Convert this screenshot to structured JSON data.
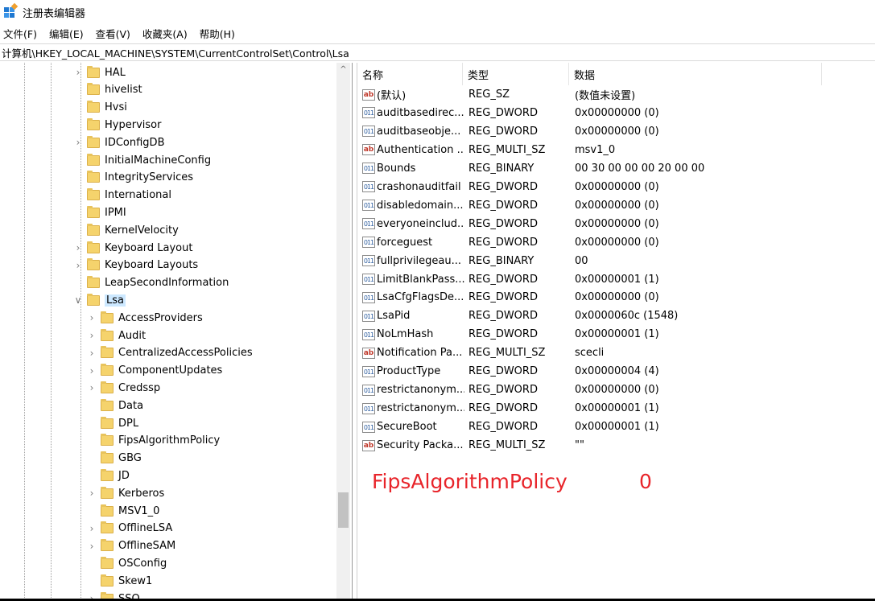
{
  "window": {
    "title": "注册表编辑器"
  },
  "menu": [
    "文件(F)",
    "编辑(E)",
    "查看(V)",
    "收藏夹(A)",
    "帮助(H)"
  ],
  "address": "计算机\\HKEY_LOCAL_MACHINE\\SYSTEM\\CurrentControlSet\\Control\\Lsa",
  "tree": {
    "level1": [
      {
        "label": "HAL",
        "expander": ">"
      },
      {
        "label": "hivelist",
        "expander": ""
      },
      {
        "label": "Hvsi",
        "expander": ""
      },
      {
        "label": "Hypervisor",
        "expander": ""
      },
      {
        "label": "IDConfigDB",
        "expander": ">"
      },
      {
        "label": "InitialMachineConfig",
        "expander": ""
      },
      {
        "label": "IntegrityServices",
        "expander": ""
      },
      {
        "label": "International",
        "expander": ""
      },
      {
        "label": "IPMI",
        "expander": ""
      },
      {
        "label": "KernelVelocity",
        "expander": ""
      },
      {
        "label": "Keyboard Layout",
        "expander": ">"
      },
      {
        "label": "Keyboard Layouts",
        "expander": ">"
      },
      {
        "label": "LeapSecondInformation",
        "expander": ""
      },
      {
        "label": "Lsa",
        "expander": "v",
        "selected": true
      }
    ],
    "level2": [
      {
        "label": "AccessProviders",
        "expander": ">"
      },
      {
        "label": "Audit",
        "expander": ">"
      },
      {
        "label": "CentralizedAccessPolicies",
        "expander": ">"
      },
      {
        "label": "ComponentUpdates",
        "expander": ">"
      },
      {
        "label": "Credssp",
        "expander": ">"
      },
      {
        "label": "Data",
        "expander": ""
      },
      {
        "label": "DPL",
        "expander": ""
      },
      {
        "label": "FipsAlgorithmPolicy",
        "expander": ""
      },
      {
        "label": "GBG",
        "expander": ""
      },
      {
        "label": "JD",
        "expander": ""
      },
      {
        "label": "Kerberos",
        "expander": ">"
      },
      {
        "label": "MSV1_0",
        "expander": ""
      },
      {
        "label": "OfflineLSA",
        "expander": ">"
      },
      {
        "label": "OfflineSAM",
        "expander": ">"
      },
      {
        "label": "OSConfig",
        "expander": ""
      },
      {
        "label": "Skew1",
        "expander": ""
      },
      {
        "label": "SSO",
        "expander": ">"
      }
    ],
    "scroll_up_glyph": "^"
  },
  "values": {
    "headers": {
      "name": "名称",
      "type": "类型",
      "data": "数据"
    },
    "rows": [
      {
        "icon": "ab",
        "name": "(默认)",
        "type": "REG_SZ",
        "data": "(数值未设置)"
      },
      {
        "icon": "bin",
        "name": "auditbasedirec...",
        "type": "REG_DWORD",
        "data": "0x00000000 (0)"
      },
      {
        "icon": "bin",
        "name": "auditbaseobje...",
        "type": "REG_DWORD",
        "data": "0x00000000 (0)"
      },
      {
        "icon": "ab",
        "name": "Authentication ...",
        "type": "REG_MULTI_SZ",
        "data": "msv1_0"
      },
      {
        "icon": "bin",
        "name": "Bounds",
        "type": "REG_BINARY",
        "data": "00 30 00 00 00 20 00 00"
      },
      {
        "icon": "bin",
        "name": "crashonauditfail",
        "type": "REG_DWORD",
        "data": "0x00000000 (0)"
      },
      {
        "icon": "bin",
        "name": "disabledomain...",
        "type": "REG_DWORD",
        "data": "0x00000000 (0)"
      },
      {
        "icon": "bin",
        "name": "everyoneinclud...",
        "type": "REG_DWORD",
        "data": "0x00000000 (0)"
      },
      {
        "icon": "bin",
        "name": "forceguest",
        "type": "REG_DWORD",
        "data": "0x00000000 (0)"
      },
      {
        "icon": "bin",
        "name": "fullprivilegeau...",
        "type": "REG_BINARY",
        "data": "00"
      },
      {
        "icon": "bin",
        "name": "LimitBlankPass...",
        "type": "REG_DWORD",
        "data": "0x00000001 (1)"
      },
      {
        "icon": "bin",
        "name": "LsaCfgFlagsDe...",
        "type": "REG_DWORD",
        "data": "0x00000000 (0)"
      },
      {
        "icon": "bin",
        "name": "LsaPid",
        "type": "REG_DWORD",
        "data": "0x0000060c (1548)"
      },
      {
        "icon": "bin",
        "name": "NoLmHash",
        "type": "REG_DWORD",
        "data": "0x00000001 (1)"
      },
      {
        "icon": "ab",
        "name": "Notification Pa...",
        "type": "REG_MULTI_SZ",
        "data": "scecli"
      },
      {
        "icon": "bin",
        "name": "ProductType",
        "type": "REG_DWORD",
        "data": "0x00000004 (4)"
      },
      {
        "icon": "bin",
        "name": "restrictanonym...",
        "type": "REG_DWORD",
        "data": "0x00000000 (0)"
      },
      {
        "icon": "bin",
        "name": "restrictanonym...",
        "type": "REG_DWORD",
        "data": "0x00000001 (1)"
      },
      {
        "icon": "bin",
        "name": "SecureBoot",
        "type": "REG_DWORD",
        "data": "0x00000001 (1)"
      },
      {
        "icon": "ab",
        "name": "Security Packa...",
        "type": "REG_MULTI_SZ",
        "data": "\"\""
      }
    ]
  },
  "annotation": {
    "name": "FipsAlgorithmPolicy",
    "value": "0",
    "color": "#e8242a"
  },
  "colors": {
    "selection": "#cce8ff",
    "folder": "#f5d36c"
  }
}
